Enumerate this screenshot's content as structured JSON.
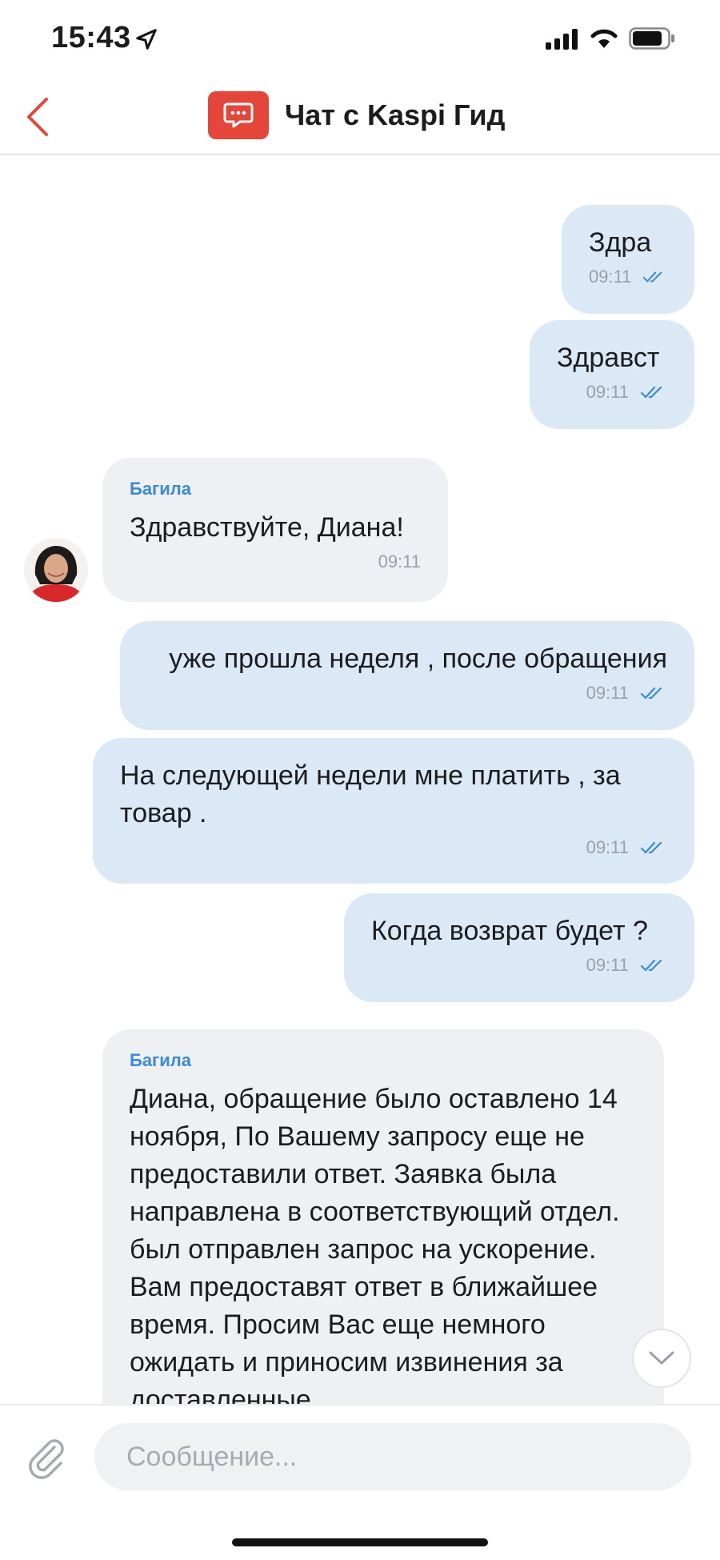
{
  "status_bar": {
    "time": "15:43"
  },
  "header": {
    "title": "Чат с Kaspi Гид"
  },
  "messages": [
    {
      "type": "out",
      "text": "Здра",
      "time": "09:11"
    },
    {
      "type": "out",
      "text": "Здравст",
      "time": "09:11"
    },
    {
      "type": "in",
      "sender": "Багила",
      "text": "Здравствуйте, Диана!",
      "time": "09:11"
    },
    {
      "type": "out",
      "text": "уже прошла неделя , после обращения",
      "time": "09:11"
    },
    {
      "type": "out",
      "text": "На следующей недели мне платить , за товар .",
      "time": "09:11"
    },
    {
      "type": "out",
      "text": "Когда возврат будет ?",
      "time": "09:11"
    },
    {
      "type": "in",
      "sender": "Багила",
      "text": "Диана, обращение было оставлено 14 ноября, По Вашему запросу еще не предоставили ответ. Заявка была направлена в соответствующий отдел. был отправлен запрос на ускорение. Вам предоставят ответ в ближайшее время. Просим Вас еще немного ожидать и приносим извинения за доставленные"
    }
  ],
  "input": {
    "placeholder": "Сообщение..."
  },
  "colors": {
    "accent": "#e4473a",
    "outgoing_bubble": "#dbe9f6",
    "incoming_bubble": "#eef0f3",
    "sender_name": "#3a8ad6",
    "read_ticks": "#3a8ad6"
  },
  "icons": [
    "location-arrow-icon",
    "signal-icon",
    "wifi-icon",
    "battery-icon",
    "back-chevron-icon",
    "chat-bubble-icon",
    "double-check-icon",
    "avatar",
    "chevron-down-icon",
    "paperclip-icon"
  ]
}
